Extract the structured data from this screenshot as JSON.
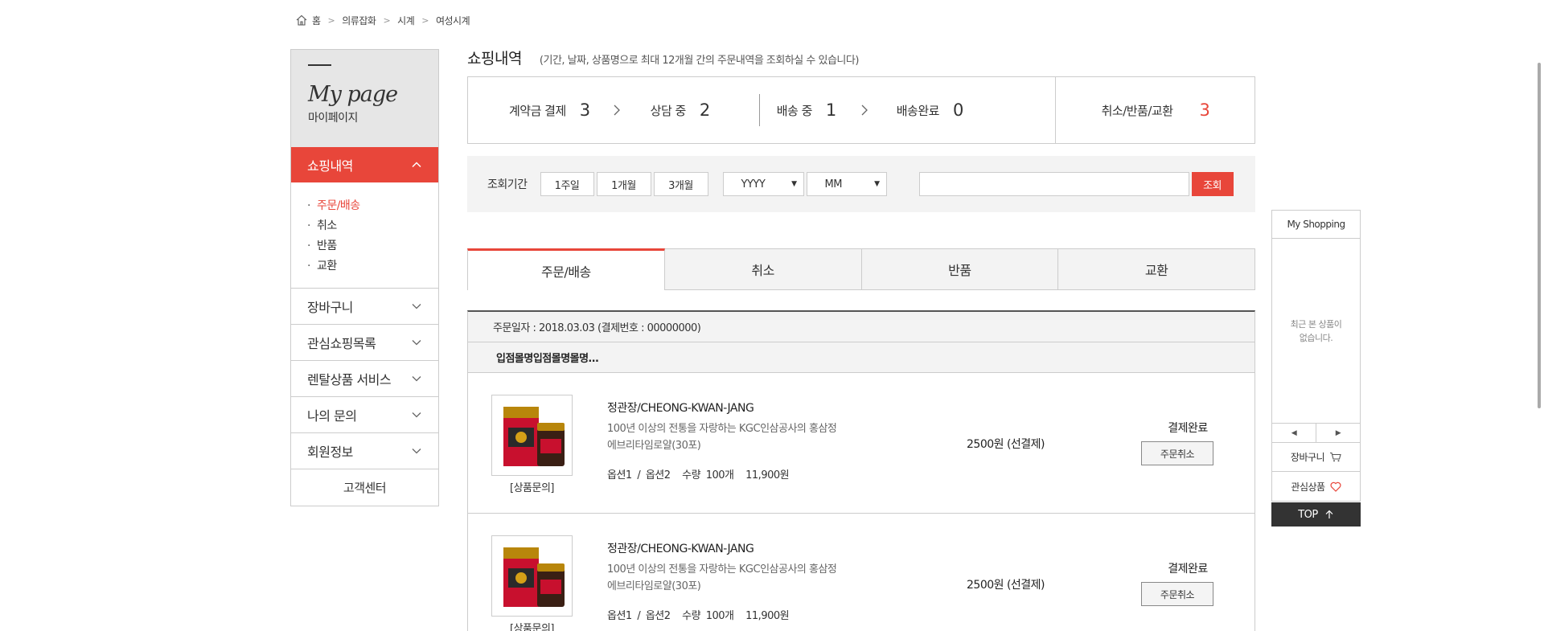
{
  "breadcrumb": [
    "홈",
    "의류잡화",
    "시계",
    "여성시계"
  ],
  "sidebar": {
    "title": "My page",
    "subtitle": "마이페이지",
    "active_menu": "쇼핑내역",
    "submenu": [
      "주문/배송",
      "취소",
      "반품",
      "교환"
    ],
    "menus": [
      "장바구니",
      "관심쇼핑목록",
      "렌탈상품 서비스",
      "나의 문의",
      "회원정보"
    ],
    "customer_center": "고객센터"
  },
  "page": {
    "title": "쇼핑내역",
    "desc": "(기간, 날짜, 상품명으로 최대 12개월 간의 주문내역을 조회하실 수 있습니다)"
  },
  "summary": {
    "deposit_label": "계약금 결제",
    "deposit_num": "3",
    "consult_label": "상담 중",
    "consult_num": "2",
    "shipping_label": "배송 중",
    "shipping_num": "1",
    "done_label": "배송완료",
    "done_num": "0",
    "cancel_label": "취소/반품/교환",
    "cancel_num": "3"
  },
  "filter": {
    "label": "조회기간",
    "btn_week": "1주일",
    "btn_month": "1개월",
    "btn_3month": "3개월",
    "year": "YYYY",
    "month": "MM",
    "search_value": "",
    "search_btn": "조회"
  },
  "tabs": [
    "주문/배송",
    "취소",
    "반품",
    "교환"
  ],
  "order": {
    "date_line": "주문일자 : 2018.03.03 (결제번호 : 00000000)",
    "store": "입점몰명입점몰명몰명…",
    "items": [
      {
        "link": "[상품문의]",
        "brand": "정관장/CHEONG-KWAN-JANG",
        "desc1": "100년 이상의 전통을 자랑하는 KGC인삼공사의 홍삼정",
        "desc2": "에브리타임로얄(30포)",
        "option": "옵션1 / 옵션2",
        "qty": "수량 100개",
        "amount": "11,900원",
        "price": "2500원 (선결제)",
        "status": "결제완료",
        "cancel": "주문취소"
      },
      {
        "link": "[상품문의]",
        "brand": "정관장/CHEONG-KWAN-JANG",
        "desc1": "100년 이상의 전통을 자랑하는 KGC인삼공사의 홍삼정",
        "desc2": "에브리타임로얄(30포)",
        "option": "옵션1 / 옵션2",
        "qty": "수량 100개",
        "amount": "11,900원",
        "price": "2500원 (선결제)",
        "status": "결제완료",
        "cancel": "주문취소"
      }
    ]
  },
  "quick": {
    "title": "My Shopping",
    "empty1": "최근 본 상품이",
    "empty2": "없습니다.",
    "prev": "◀",
    "next": "▶",
    "cart": "장바구니",
    "wish": "관심상품",
    "top": "TOP"
  },
  "colors": {
    "accent": "#e8463a",
    "dark": "#333333"
  }
}
